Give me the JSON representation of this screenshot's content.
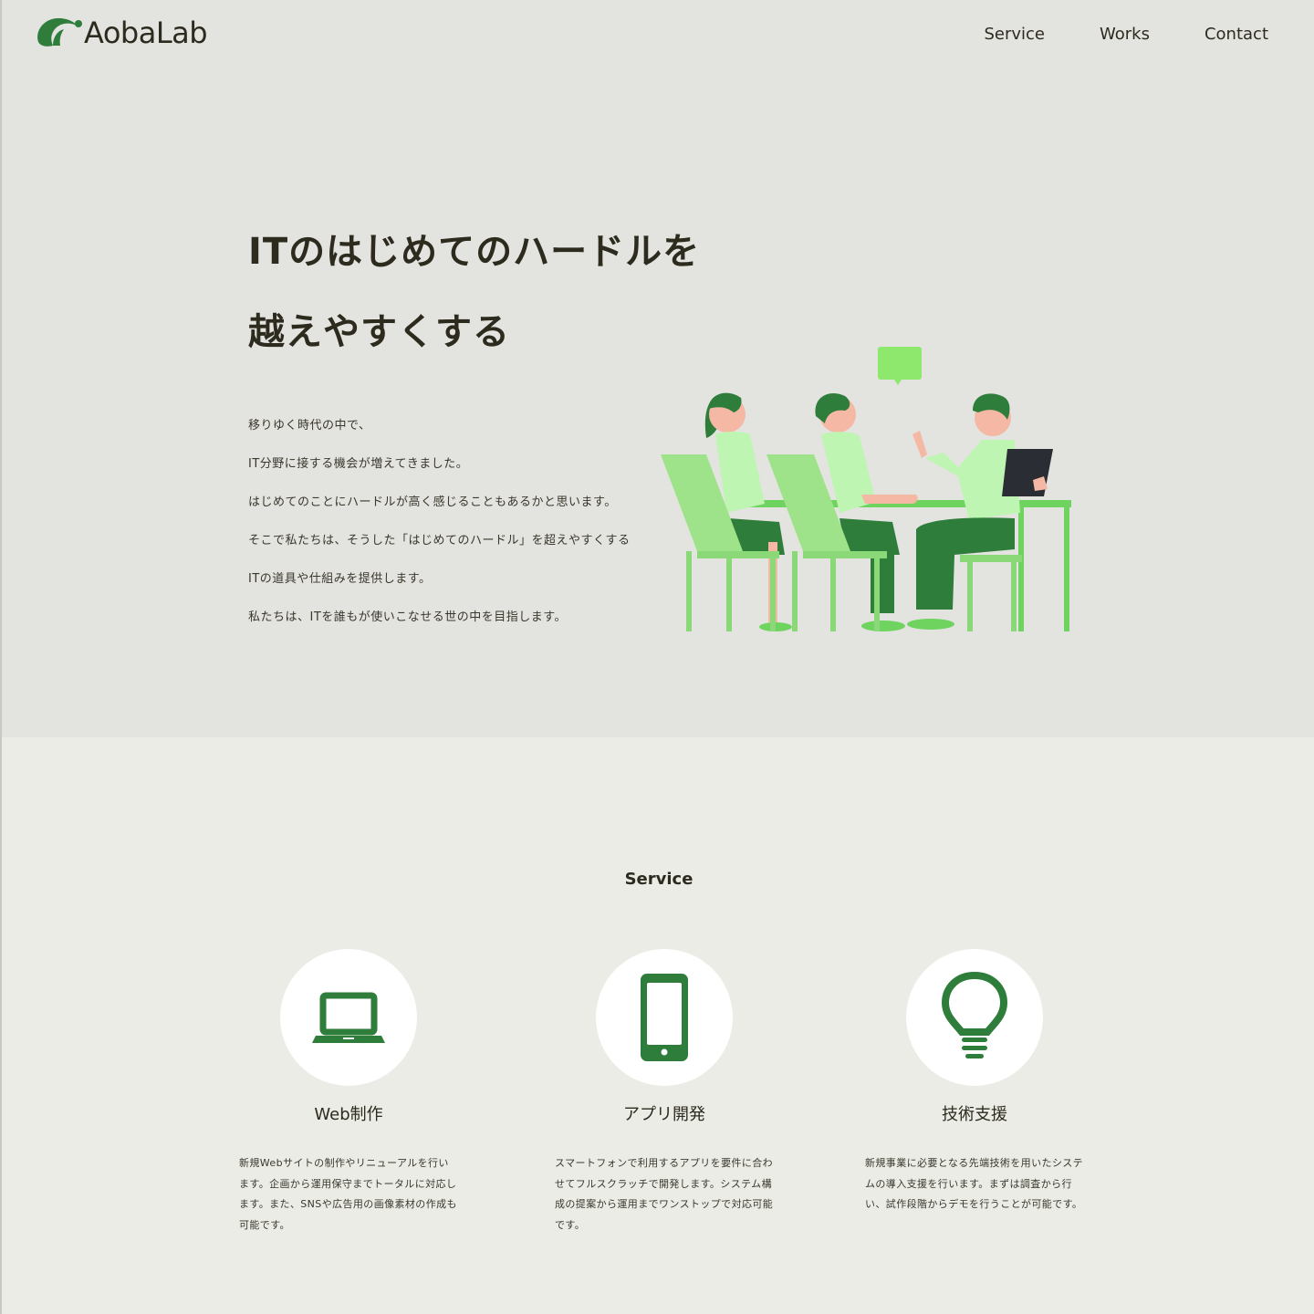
{
  "brand": {
    "name": "AobaLab",
    "color": "#2e7d3a"
  },
  "nav": {
    "items": [
      "Service",
      "Works",
      "Contact"
    ]
  },
  "hero": {
    "headline_line1": "ITのはじめてのハードルを",
    "headline_line2": "越えやすくする",
    "paragraphs": [
      "移りゆく時代の中で、",
      "IT分野に接する機会が増えてきました。",
      "はじめてのことにハードルが高く感じることもあるかと思います。",
      "そこで私たちは、そうした「はじめてのハードル」を超えやすくする",
      "ITの道具や仕組みを提供します。",
      "私たちは、ITを誰もが使いこなせる世の中を目指します。"
    ],
    "illustration": "team-meeting-illustration"
  },
  "service": {
    "title": "Service",
    "cards": [
      {
        "icon": "laptop-icon",
        "title": "Web制作",
        "description": "新規Webサイトの制作やリニューアルを行います。企画から運用保守までトータルに対応します。また、SNSや広告用の画像素材の作成も可能です。"
      },
      {
        "icon": "smartphone-icon",
        "title": "アプリ開発",
        "description": "スマートフォンで利用するアプリを要件に合わせてフルスクラッチで開発します。システム構成の提案から運用までワンストップで対応可能です。"
      },
      {
        "icon": "lightbulb-icon",
        "title": "技術支援",
        "description": "新規事業に必要となる先端技術を用いたシステムの導入支援を行います。まずは調査から行い、試作段階からデモを行うことが可能です。"
      }
    ]
  },
  "colors": {
    "hero_bg": "#e3e3df",
    "section_bg": "#ebece6",
    "accent_dark": "#2e7d3a",
    "accent_light": "#8ee07a",
    "text": "#2d2a1e"
  }
}
